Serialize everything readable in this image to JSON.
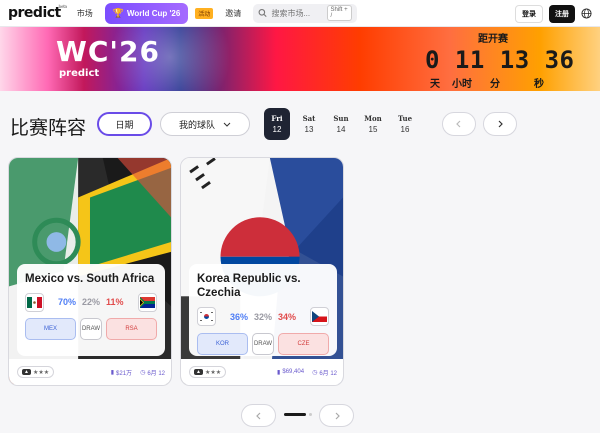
{
  "nav": {
    "logo": "predict",
    "logo_sup": "beta",
    "markets": "市场",
    "world_cup": "World Cup '26",
    "promo": "活动",
    "invite": "邀请",
    "search_placeholder": "搜索市场...",
    "search_shortcut": "Shift + /",
    "login": "登录",
    "signup": "注册"
  },
  "banner": {
    "title": "WC'26",
    "subtitle": "predict",
    "countdown_label": "距开赛",
    "countdown_digits": "0 11 13 36",
    "units": [
      "天",
      "小时",
      "分",
      "秒"
    ]
  },
  "lineup": {
    "title": "比赛阵容",
    "date_filter": "日期",
    "team_filter": "我的球队",
    "days": [
      {
        "name": "Fri",
        "date": "12",
        "active": true
      },
      {
        "name": "Sat",
        "date": "13",
        "active": false
      },
      {
        "name": "Sun",
        "date": "14",
        "active": false
      },
      {
        "name": "Mon",
        "date": "15",
        "active": false
      },
      {
        "name": "Tue",
        "date": "16",
        "active": false
      }
    ]
  },
  "matches": [
    {
      "title": "Mexico vs. South Africa",
      "home_pct": "70%",
      "draw_pct": "22%",
      "away_pct": "11%",
      "home_code": "MEX",
      "draw_label": "DRAW",
      "away_code": "RSA",
      "rating": "★★★",
      "volume": "$21万",
      "date": "6月 12"
    },
    {
      "title": "Korea Republic vs. Czechia",
      "home_pct": "36%",
      "draw_pct": "32%",
      "away_pct": "34%",
      "home_code": "KOR",
      "draw_label": "DRAW",
      "away_code": "CZE",
      "rating": "★★★",
      "volume": "$69,404",
      "date": "6月 12"
    }
  ],
  "colors": {
    "accent": "#6a4ce8",
    "home": "#4f7ef5",
    "away": "#e14b4b",
    "dark": "#1f2433"
  }
}
